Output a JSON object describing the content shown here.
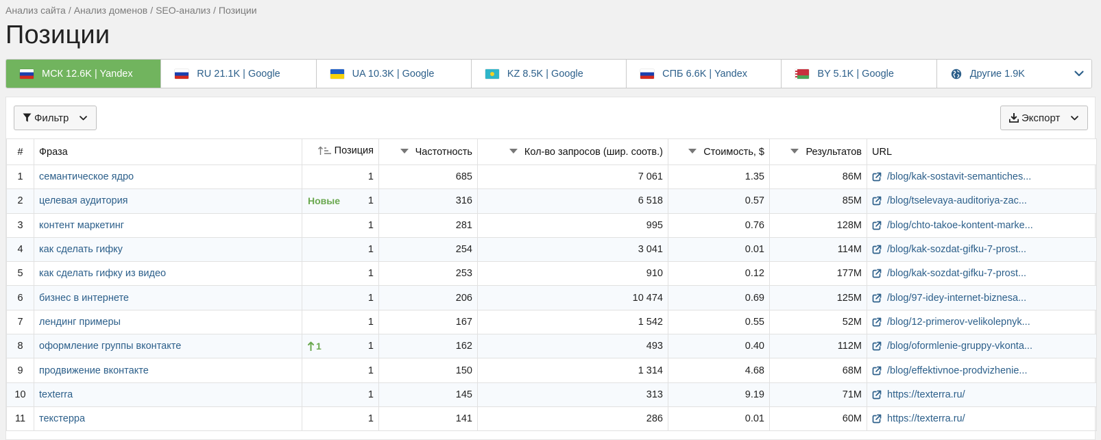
{
  "breadcrumb": [
    "Анализ сайта",
    "Анализ доменов",
    "SEO-анализ",
    "Позиции"
  ],
  "page_title": "Позиции",
  "region_tabs": [
    {
      "label": "МСК 12.6K | Yandex",
      "flag": "ru",
      "active": true
    },
    {
      "label": "RU 21.1K | Google",
      "flag": "ru",
      "active": false
    },
    {
      "label": "UA 10.3K | Google",
      "flag": "ua",
      "active": false
    },
    {
      "label": "KZ 8.5K | Google",
      "flag": "kz",
      "active": false
    },
    {
      "label": "СПБ 6.6K | Yandex",
      "flag": "ru",
      "active": false
    },
    {
      "label": "BY 5.1K | Google",
      "flag": "by",
      "active": false
    },
    {
      "label": "Другие 1.9K",
      "flag": "globe-icon",
      "active": false
    }
  ],
  "toolbar": {
    "filter_label": "Фильтр",
    "export_label": "Экспорт"
  },
  "table": {
    "headers": {
      "idx": "#",
      "phrase": "Фраза",
      "position": "Позиция",
      "frequency": "Частотность",
      "queries": "Кол-во запросов (шир. соотв.)",
      "cost": "Стоимость, $",
      "results": "Результатов",
      "url": "URL"
    },
    "rows": [
      {
        "idx": "1",
        "phrase": "семантическое ядро",
        "badge": "",
        "position": "1",
        "frequency": "685",
        "queries": "7 061",
        "cost": "1.35",
        "results": "86M",
        "url": "/blog/kak-sostavit-semantiches..."
      },
      {
        "idx": "2",
        "phrase": "целевая аудитория",
        "badge": "Новые",
        "position": "1",
        "frequency": "316",
        "queries": "6 518",
        "cost": "0.57",
        "results": "85M",
        "url": "/blog/tselevaya-auditoriya-zac..."
      },
      {
        "idx": "3",
        "phrase": "контент маркетинг",
        "badge": "",
        "position": "1",
        "frequency": "281",
        "queries": "995",
        "cost": "0.76",
        "results": "128M",
        "url": "/blog/chto-takoe-kontent-marke..."
      },
      {
        "idx": "4",
        "phrase": "как сделать гифку",
        "badge": "",
        "position": "1",
        "frequency": "254",
        "queries": "3 041",
        "cost": "0.01",
        "results": "114M",
        "url": "/blog/kak-sozdat-gifku-7-prost..."
      },
      {
        "idx": "5",
        "phrase": "как сделать гифку из видео",
        "badge": "",
        "position": "1",
        "frequency": "253",
        "queries": "910",
        "cost": "0.12",
        "results": "177M",
        "url": "/blog/kak-sozdat-gifku-7-prost..."
      },
      {
        "idx": "6",
        "phrase": "бизнес в интернете",
        "badge": "",
        "position": "1",
        "frequency": "206",
        "queries": "10 474",
        "cost": "0.69",
        "results": "125M",
        "url": "/blog/97-idey-internet-biznesa..."
      },
      {
        "idx": "7",
        "phrase": "лендинг примеры",
        "badge": "",
        "position": "1",
        "frequency": "167",
        "queries": "1 542",
        "cost": "0.55",
        "results": "52M",
        "url": "/blog/12-primerov-velikolepnyk..."
      },
      {
        "idx": "8",
        "phrase": "оформление группы вконтакте",
        "badge": "1",
        "badge_type": "up",
        "position": "1",
        "frequency": "162",
        "queries": "493",
        "cost": "0.40",
        "results": "112M",
        "url": "/blog/oformlenie-gruppy-vkonta..."
      },
      {
        "idx": "9",
        "phrase": "продвижение вконтакте",
        "badge": "",
        "position": "1",
        "frequency": "150",
        "queries": "1 314",
        "cost": "4.68",
        "results": "68M",
        "url": "/blog/effektivnoe-prodvizhenie..."
      },
      {
        "idx": "10",
        "phrase": "texterra",
        "badge": "",
        "position": "1",
        "frequency": "145",
        "queries": "313",
        "cost": "9.19",
        "results": "71M",
        "url": "https://texterra.ru/"
      },
      {
        "idx": "11",
        "phrase": "текстерра",
        "badge": "",
        "position": "1",
        "frequency": "141",
        "queries": "286",
        "cost": "0.01",
        "results": "60M",
        "url": "https://texterra.ru/"
      }
    ]
  },
  "colors": {
    "active_tab": "#71b45e",
    "link": "#2c5f8a",
    "badge_green": "#6aa84f"
  }
}
